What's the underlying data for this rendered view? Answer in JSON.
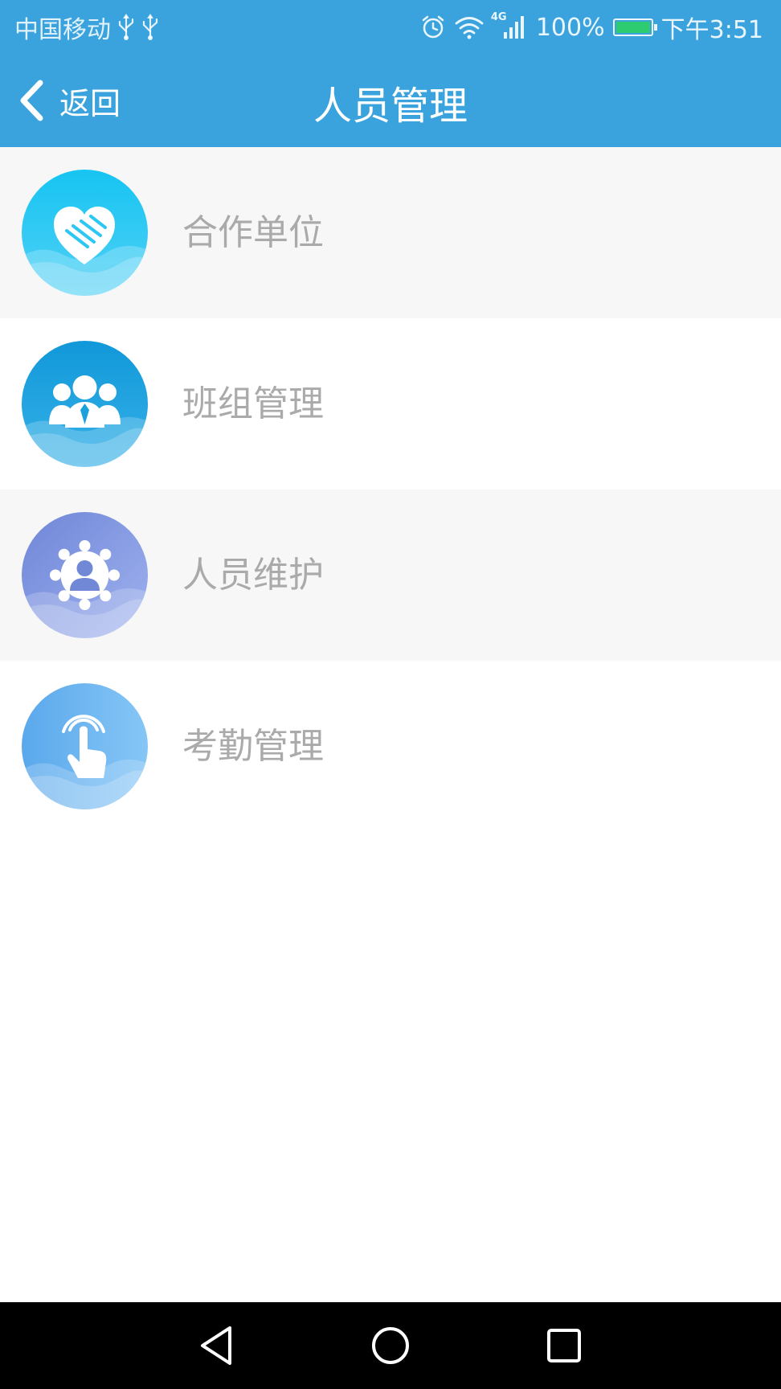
{
  "status_bar": {
    "carrier": "中国移动",
    "network": "4G",
    "battery_percent": "100%",
    "battery_level": 1.0,
    "time": "下午3:51",
    "battery_color": "#2ecc71"
  },
  "header": {
    "back_label": "返回",
    "title": "人员管理",
    "background": "#3aa3dd"
  },
  "menu": {
    "items": [
      {
        "label": "合作单位",
        "icon": "handshake-icon"
      },
      {
        "label": "班组管理",
        "icon": "team-icon"
      },
      {
        "label": "人员维护",
        "icon": "user-settings-icon"
      },
      {
        "label": "考勤管理",
        "icon": "finger-tap-icon"
      }
    ]
  },
  "system_nav": {
    "back": "back-triangle-icon",
    "home": "home-circle-icon",
    "recents": "recents-square-icon"
  }
}
